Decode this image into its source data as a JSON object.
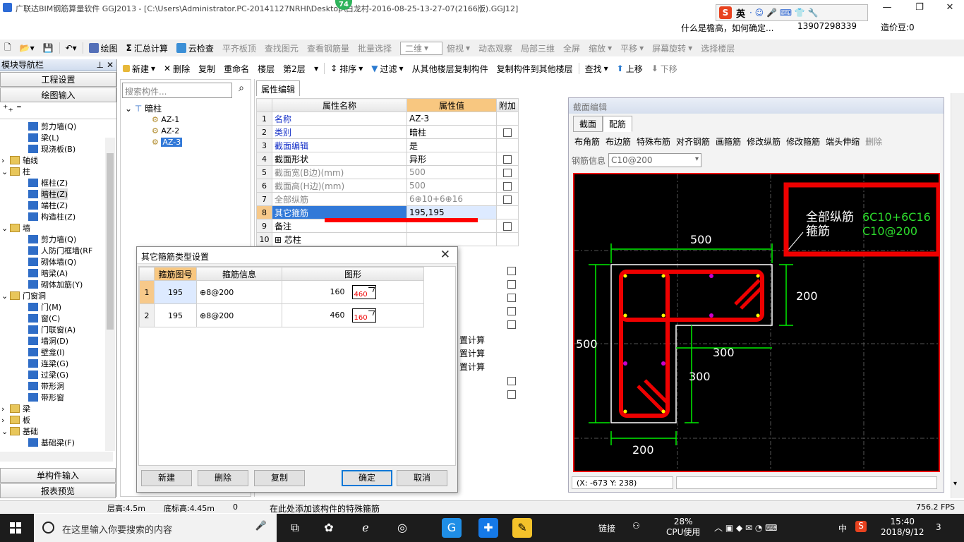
{
  "titlebar": {
    "title": "广联达BIM钢筋算量软件 GGJ2013 - [C:\\Users\\Administrator.PC-20141127NRHI\\Desktop\\白龙村-2016-08-25-13-27-07(2166版).GGJ12]",
    "badge": "74",
    "min": "—",
    "restore": "❐",
    "close": "✕"
  },
  "ime": {
    "lang": "英",
    "logo": "S",
    "icons": "· ☺ 🎤 ⌨ 👕 🔧"
  },
  "infobar": {
    "question": "什么是檐高，如何确定...",
    "phone": "13907298339",
    "coin": "造价豆:0"
  },
  "toolbar1": {
    "draw": "绘图",
    "sum": "汇总计算",
    "cloud": "云检查",
    "flat": "平齐板顶",
    "find": "查找图元",
    "view_rebar": "查看钢筋量",
    "batch": "批量选择",
    "dim": "二维",
    "top": "俯视",
    "dynamic": "动态观察",
    "local3d": "局部三维",
    "fullscreen": "全屏",
    "zoom": "缩放",
    "pan": "平移",
    "rotate": "屏幕旋转",
    "floor_sel": "选择楼层"
  },
  "toolbar2": {
    "new": "新建",
    "delete": "删除",
    "copy": "复制",
    "rename": "重命名",
    "floor_label": "楼层",
    "floor": "第2层",
    "sort": "排序",
    "filter": "过滤",
    "copy_from": "从其他楼层复制构件",
    "copy_to": "复制构件到其他楼层",
    "find": "查找",
    "up": "上移",
    "down": "下移"
  },
  "nav": {
    "title": "模块导航栏",
    "pin": "⊥",
    "close": "✕",
    "btn_setting": "工程设置",
    "btn_draw": "绘图输入",
    "btn_single": "单构件输入",
    "btn_report": "报表预览",
    "tree": [
      "剪力墙(Q)",
      "梁(L)",
      "现浇板(B)",
      "轴线",
      "柱",
      "框柱(Z)",
      "暗柱(Z)",
      "端柱(Z)",
      "构造柱(Z)",
      "墙",
      "剪力墙(Q)",
      "人防门框墙(RF",
      "砌体墙(Q)",
      "暗梁(A)",
      "砌体加筋(Y)",
      "门窗洞",
      "门(M)",
      "窗(C)",
      "门联窗(A)",
      "墙洞(D)",
      "壁龛(I)",
      "连梁(G)",
      "过梁(G)",
      "带形洞",
      "带形窗",
      "梁",
      "板",
      "基础",
      "基础梁(F)"
    ]
  },
  "comp": {
    "search_placeholder": "搜索构件...",
    "root": "暗柱",
    "items": [
      "AZ-1",
      "AZ-2",
      "AZ-3"
    ]
  },
  "props": {
    "tab": "属性编辑",
    "headers": [
      "属性名称",
      "属性值",
      "附加"
    ],
    "rows": [
      {
        "n": "1",
        "name": "名称",
        "value": "AZ-3"
      },
      {
        "n": "2",
        "name": "类别",
        "value": "暗柱"
      },
      {
        "n": "3",
        "name": "截面编辑",
        "value": "是"
      },
      {
        "n": "4",
        "name": "截面形状",
        "value": "异形"
      },
      {
        "n": "5",
        "name": "截面宽(B边)(mm)",
        "value": "500"
      },
      {
        "n": "6",
        "name": "截面高(H边)(mm)",
        "value": "500"
      },
      {
        "n": "7",
        "name": "全部纵筋",
        "value": "6⊕10+6⊕16"
      },
      {
        "n": "8",
        "name": "其它箍筋",
        "value": "195,195"
      },
      {
        "n": "9",
        "name": "备注",
        "value": ""
      },
      {
        "n": "10",
        "name": "⊞ 芯柱",
        "value": ""
      }
    ],
    "calc": [
      "置计算",
      "置计算",
      "置计算"
    ]
  },
  "section": {
    "title": "截面编辑",
    "tabs": [
      "截面",
      "配筋"
    ],
    "tools": [
      "布角筋",
      "布边筋",
      "特殊布筋",
      "对齐钢筋",
      "画箍筋",
      "修改纵筋",
      "修改箍筋",
      "端头伸缩",
      "删除"
    ],
    "info_label": "钢筋信息",
    "info_value": "C10@200",
    "label_all": "全部纵筋",
    "label_stirrup": "箍筋",
    "value_all": "6C10+6C16",
    "value_stirrup": "C10@200",
    "dims": {
      "top": "500",
      "left": "500",
      "right": "200",
      "mid": "300",
      "inner": "300",
      "bottom": "200"
    },
    "coords": "(X: -673 Y: 238)"
  },
  "dialog": {
    "title": "其它箍筋类型设置",
    "headers": [
      "箍筋图号",
      "箍筋信息",
      "图形"
    ],
    "rows": [
      {
        "n": "1",
        "code": "195",
        "info": "⊕8@200",
        "a": "160",
        "b": "460"
      },
      {
        "n": "2",
        "code": "195",
        "info": "⊕8@200",
        "a": "460",
        "b": "160"
      }
    ],
    "btn_new": "新建",
    "btn_delete": "删除",
    "btn_copy": "复制",
    "btn_ok": "确定",
    "btn_cancel": "取消"
  },
  "status": {
    "floor_h": "层高:4.5m",
    "base_h": "底标高:4.45m",
    "zero": "0",
    "hint": "在此处添加该构件的特殊箍筋",
    "fps": "756.2 FPS"
  },
  "taskbar": {
    "search": "在这里输入你要搜索的内容",
    "link": "链接",
    "cpu_pct": "28%",
    "cpu_label": "CPU使用",
    "lang": "中",
    "time": "15:40",
    "date": "2018/9/12",
    "notif": "3"
  }
}
